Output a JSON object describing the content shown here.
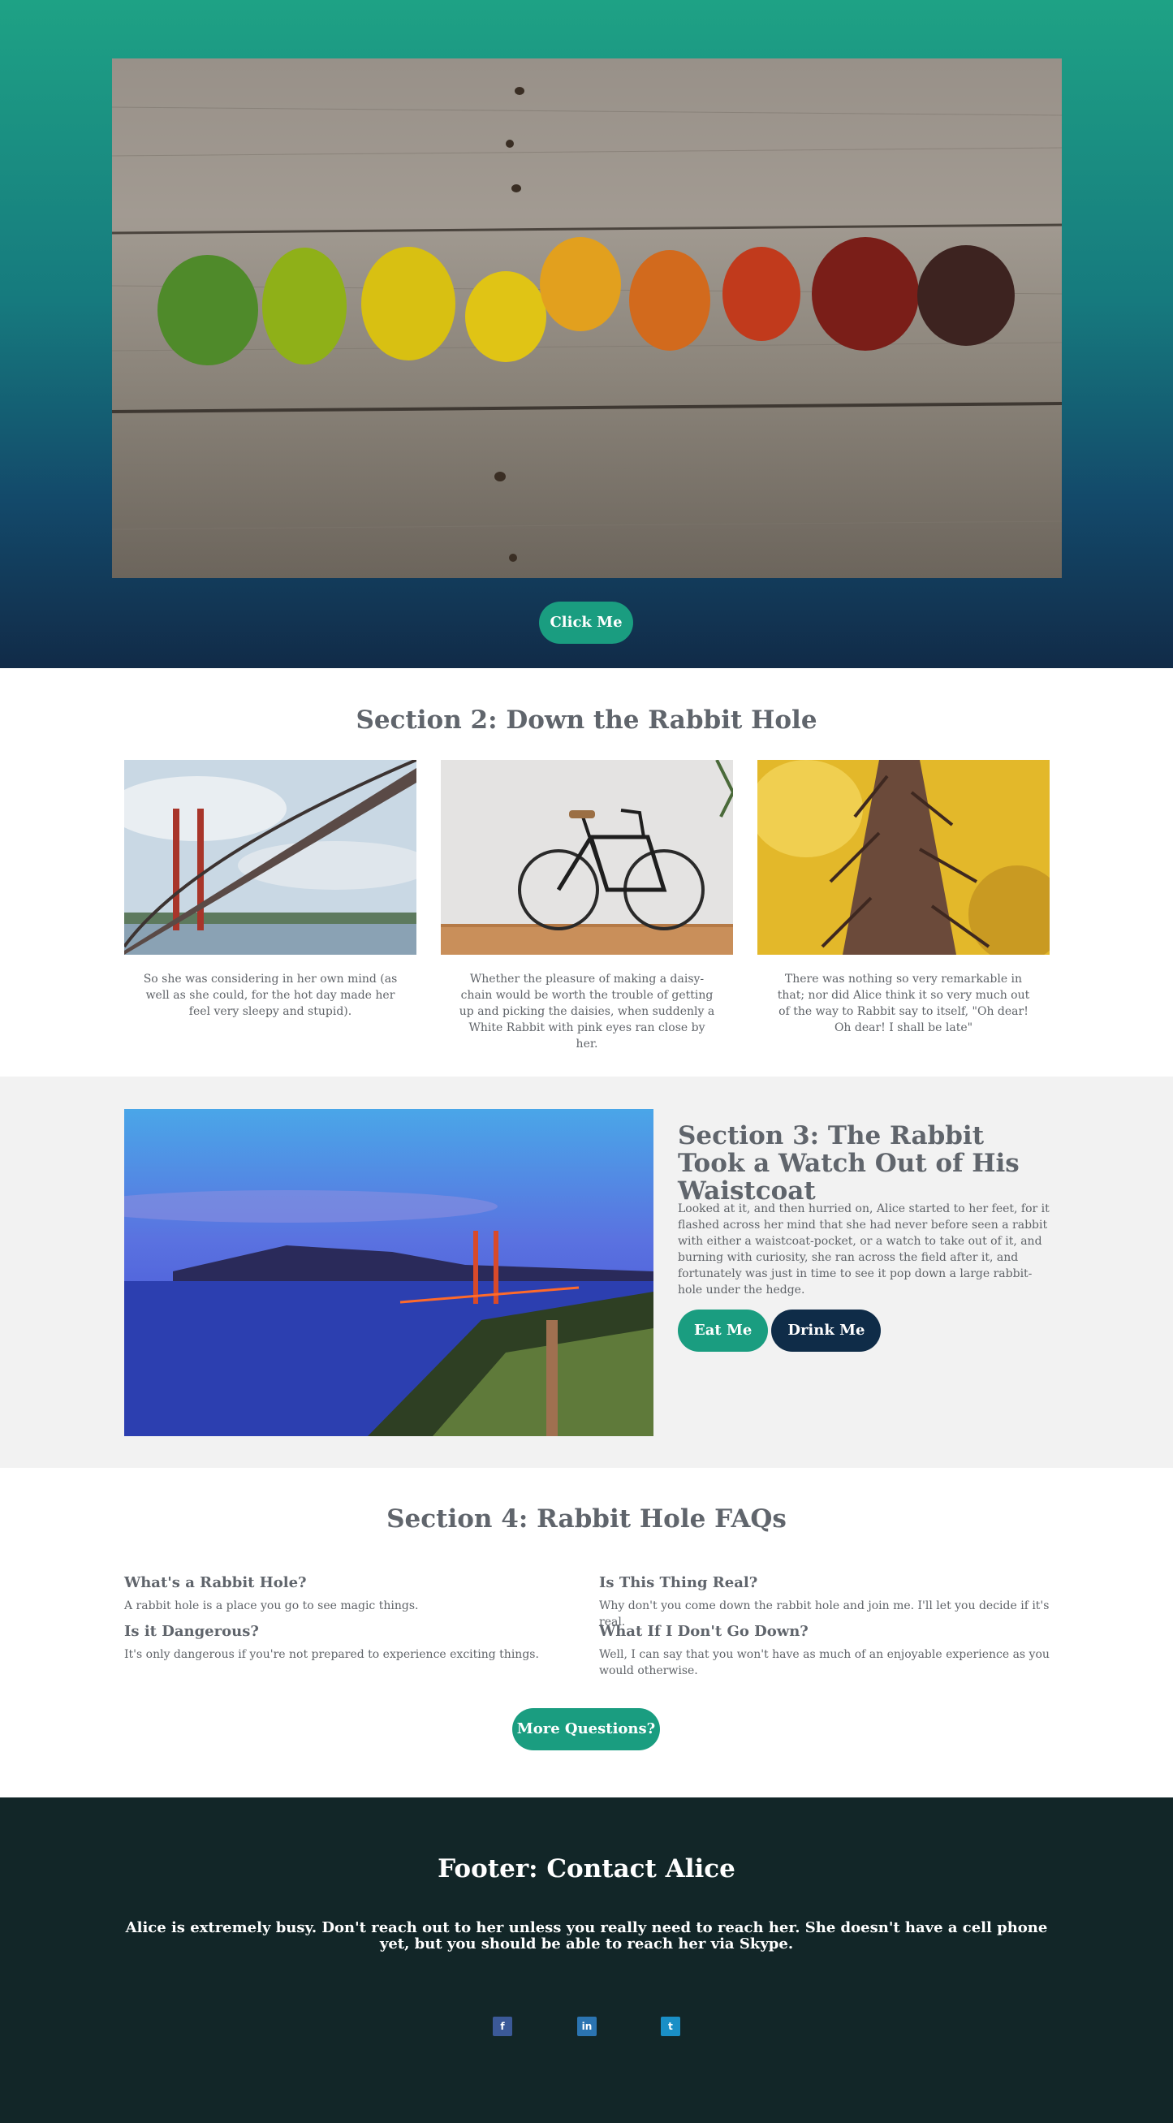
{
  "hero": {
    "image_alt": "Row of autumn leaves on wooden planks",
    "button_label": "Click Me"
  },
  "section2": {
    "title": "Section 2: Down the Rabbit Hole",
    "cards": [
      {
        "image": "bridge-photo",
        "text": "So she was considering in her own mind (as well as she could, for the hot day made her feel very sleepy and stupid)."
      },
      {
        "image": "bicycle-photo",
        "text": "Whether the pleasure of making a daisy-chain would be worth the trouble of getting up and picking the daisies, when suddenly a White Rabbit with pink eyes ran close by her."
      },
      {
        "image": "tree-bark-photo",
        "text": "There was nothing so very remarkable in that; nor did Alice think it so very much out of the way to Rabbit say to itself, \"Oh dear! Oh dear! I shall be late\""
      }
    ]
  },
  "section3": {
    "title": "Section 3: The Rabbit Took a Watch Out of His Waistcoat",
    "body": "Looked at it, and then hurried on, Alice started to her feet, for it flashed across her mind that she had never before seen a rabbit with either a waistcoat-pocket, or a watch to take out of it, and burning with curiosity, she ran across the field after it, and fortunately was just in time to see it pop down a large rabbit-hole under the hedge.",
    "button_primary": "Eat Me",
    "button_secondary": "Drink Me"
  },
  "section4": {
    "title": "Section 4: Rabbit Hole FAQs",
    "faqs": [
      {
        "q": "What's a Rabbit Hole?",
        "a": "A rabbit hole is a place you go to see magic things."
      },
      {
        "q": "Is it Dangerous?",
        "a": "It's only dangerous if you're not prepared to experience exciting things."
      },
      {
        "q": "Is This Thing Real?",
        "a": "Why don't you come down the rabbit hole and join me. I'll let you decide if it's real."
      },
      {
        "q": "What If I Don't Go Down?",
        "a": "Well, I can say that you won't have as much of an enjoyable experience as you would otherwise."
      }
    ],
    "button_label": "More Questions?"
  },
  "footer": {
    "title": "Footer: Contact Alice",
    "text": "Alice is extremely busy. Don't reach out to her unless you really need to reach her. She doesn't have a cell phone yet, but you should be able to reach her via Skype.",
    "social": [
      {
        "icon": "facebook-icon",
        "glyph": "f",
        "color": "#3b5998"
      },
      {
        "icon": "linkedin-icon",
        "glyph": "in",
        "color": "#2b74b1"
      },
      {
        "icon": "twitter-icon",
        "glyph": "t",
        "color": "#1a8fc6"
      }
    ]
  },
  "colors": {
    "accent_green": "#1a9d80",
    "navy": "#0f2c48",
    "footer_bg": "#122628",
    "section_gray": "#f2f2f2"
  }
}
